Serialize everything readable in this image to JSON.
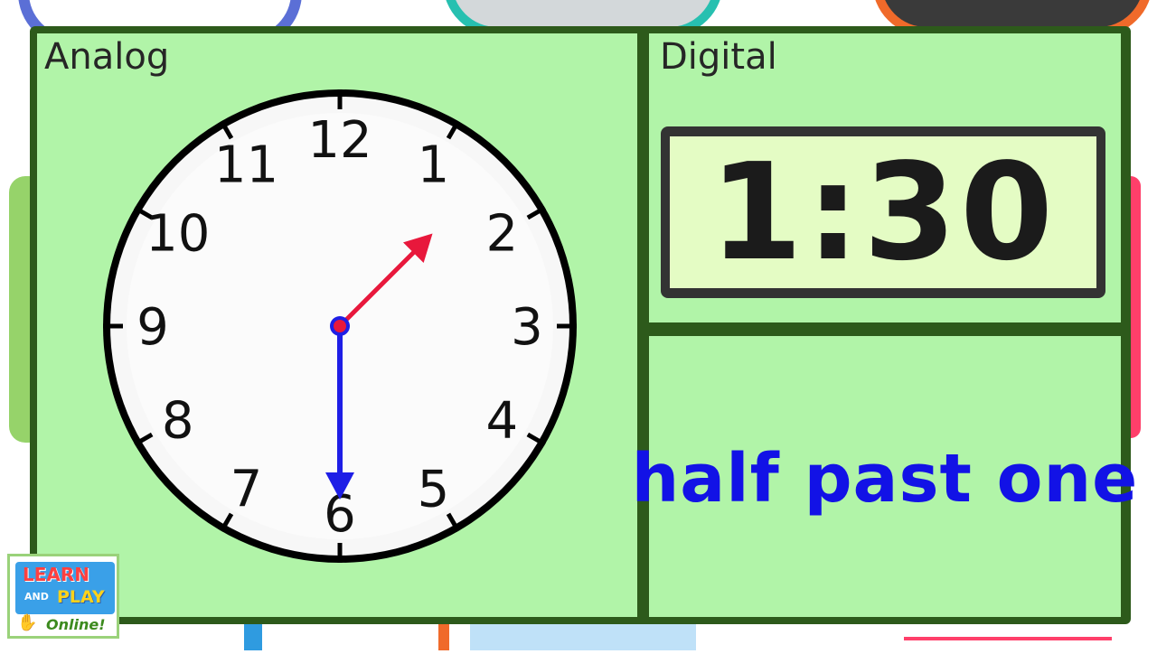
{
  "analog": {
    "title": "Analog"
  },
  "digital": {
    "title": "Digital",
    "time": "1:30"
  },
  "words": {
    "text": "half past one"
  },
  "clock": {
    "numerals": [
      "12",
      "1",
      "2",
      "3",
      "4",
      "5",
      "6",
      "7",
      "8",
      "9",
      "10",
      "11"
    ],
    "hour": 1,
    "minute": 30,
    "hour_hand_color": "#e8183c",
    "minute_hand_color": "#1e1ee6"
  },
  "logo": {
    "line1": "LEARN",
    "line2": "AND",
    "line3": "PLAY",
    "line4": "Online!"
  },
  "colors": {
    "panel": "#b1f4a8",
    "frame": "#2d5a1b",
    "display": "#e4fcc4",
    "words": "#1212e6"
  }
}
